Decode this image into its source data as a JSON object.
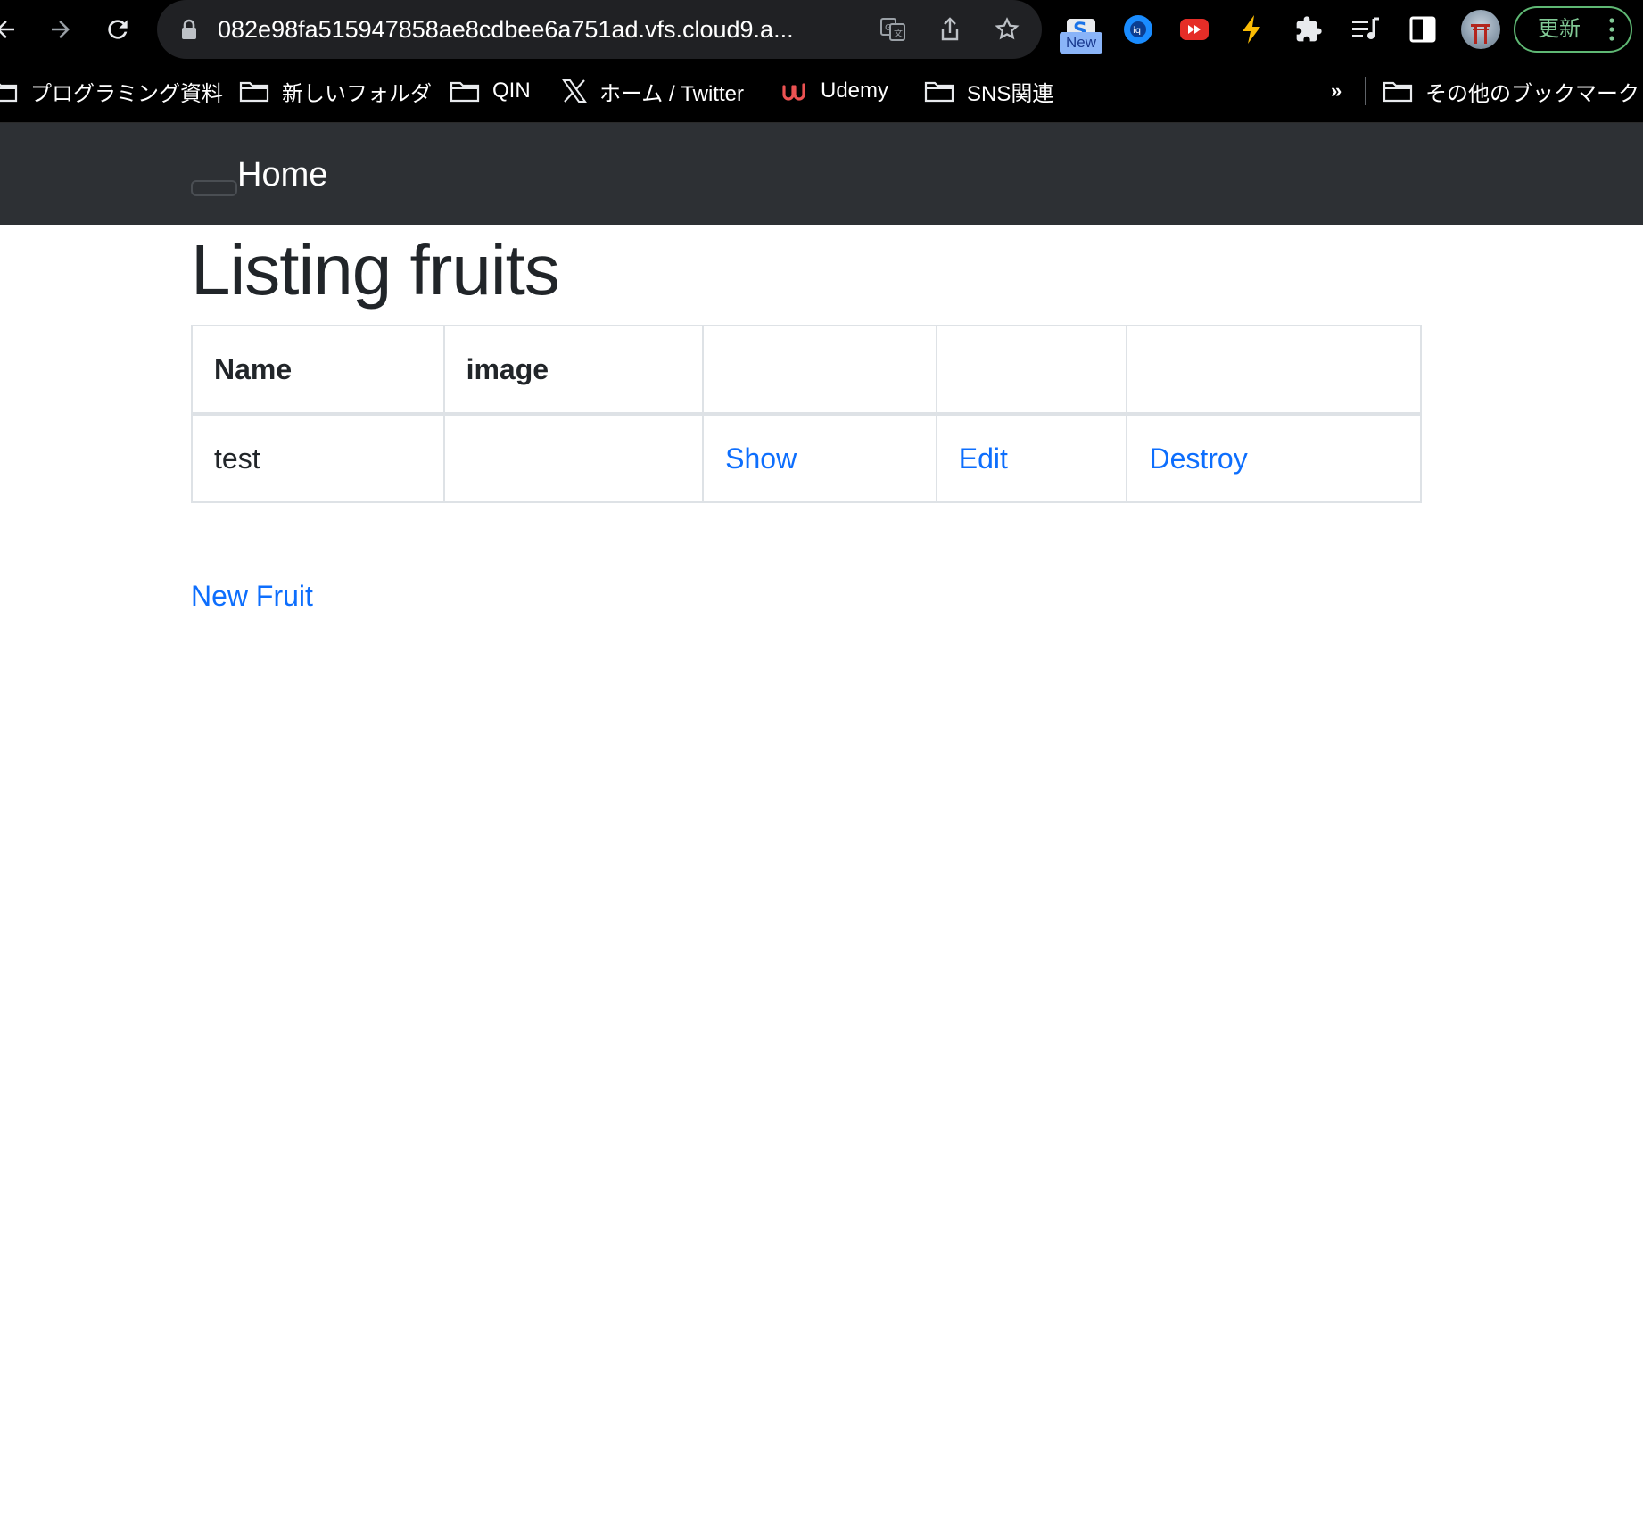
{
  "browser": {
    "url": "082e98fa515947858ae8cdbee6a751ad.vfs.cloud9.a...",
    "badge_new": "New",
    "update_label": "更新",
    "icons": [
      "back-icon",
      "forward-icon",
      "reload-icon",
      "lock-icon",
      "translate-icon",
      "share-icon",
      "bookmark-star-icon",
      "extension-s-icon",
      "extension-iq-icon",
      "extension-youtube-icon",
      "extension-bolt-icon",
      "extensions-puzzle-icon",
      "reading-list-icon",
      "side-panel-icon",
      "profile-avatar",
      "more-menu-icon"
    ]
  },
  "bookmarks": {
    "items": [
      {
        "label": "プログラミング資料",
        "icon": "folder-icon"
      },
      {
        "label": "新しいフォルダ",
        "icon": "folder-icon"
      },
      {
        "label": "QIN",
        "icon": "folder-icon"
      },
      {
        "label": "ホーム / Twitter",
        "icon": "x-logo-icon"
      },
      {
        "label": "Udemy",
        "icon": "udemy-logo-icon"
      },
      {
        "label": "SNS関連",
        "icon": "folder-icon"
      }
    ],
    "overflow": "»",
    "other": "その他のブックマーク"
  },
  "navbar": {
    "home": "Home"
  },
  "main": {
    "title": "Listing fruits",
    "table": {
      "headers": [
        "Name",
        "image",
        "",
        "",
        ""
      ],
      "rows": [
        {
          "name": "test",
          "image": "",
          "show": "Show",
          "edit": "Edit",
          "destroy": "Destroy"
        }
      ]
    },
    "new_link": "New Fruit"
  },
  "colors": {
    "navbar_bg": "#2d3034",
    "link": "#0d6efd",
    "text": "#212529",
    "update_green": "#81c995"
  }
}
